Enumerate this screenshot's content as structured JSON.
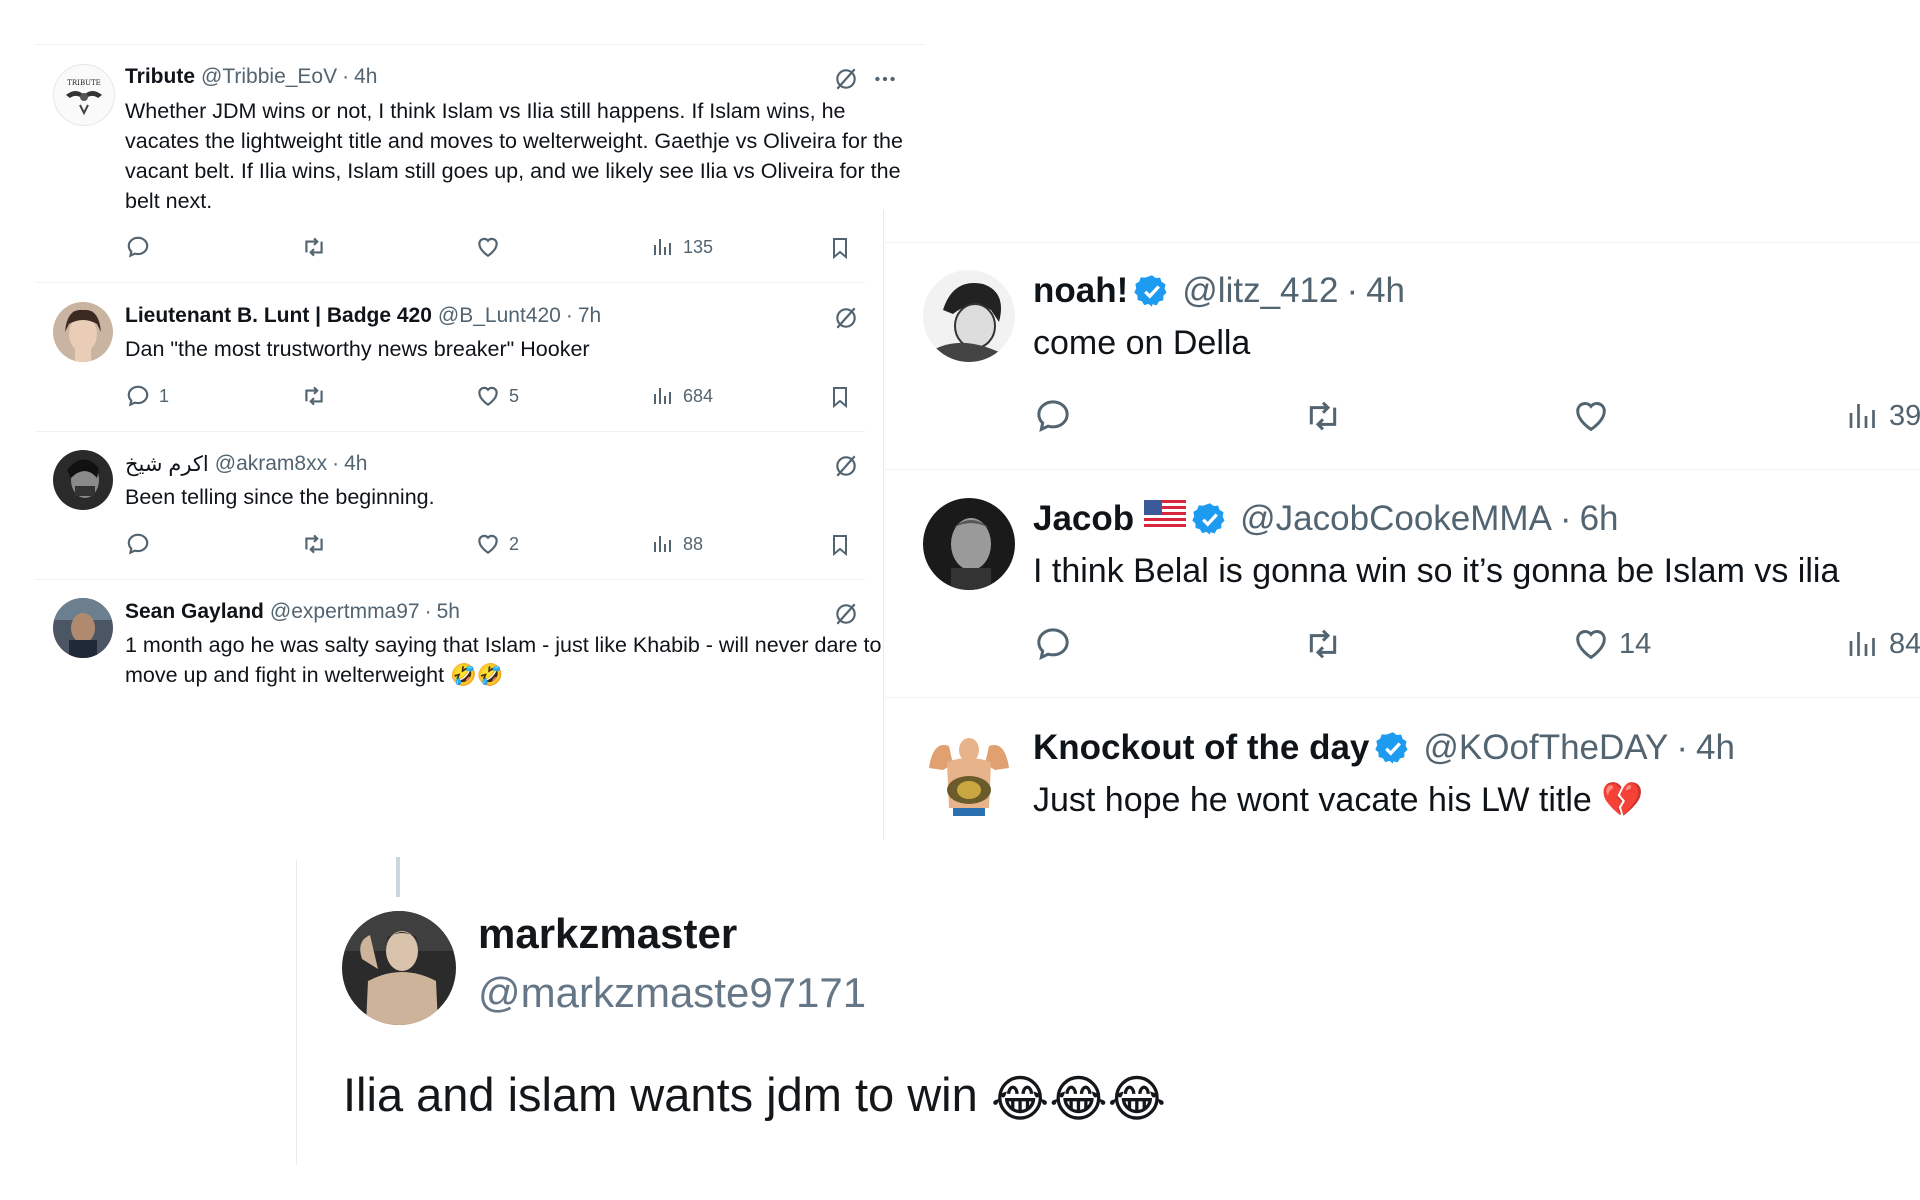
{
  "small_feed": {
    "tweets": [
      {
        "name": "Tribute",
        "handle": "@Tribbie_EoV",
        "time": "4h",
        "text": "Whether JDM wins or not, I think Islam vs Ilia still happens. If Islam wins, he vacates the lightweight title and moves to welterweight. Gaethje vs Oliveira for the vacant belt. If Ilia wins, Islam still goes up, and we likely see Ilia vs Oliveira for the belt next.",
        "replies": "",
        "likes": "",
        "views": "135"
      },
      {
        "name": "Lieutenant B. Lunt | Badge 420",
        "handle": "@B_Lunt420",
        "time": "7h",
        "text": "Dan \"the most trustworthy news breaker\" Hooker",
        "replies": "1",
        "likes": "5",
        "views": "684"
      },
      {
        "name": "اكرم شيخ",
        "handle": "@akram8xx",
        "time": "4h",
        "text": "Been telling since the beginning.",
        "replies": "",
        "likes": "2",
        "views": "88"
      },
      {
        "name": "Sean Gayland",
        "handle": "@expertmma97",
        "time": "5h",
        "text": "1 month ago he was salty saying that Islam - just like Khabib - will never dare to move up and fight in welterweight 🤣🤣"
      }
    ]
  },
  "large_feed": {
    "tweets": [
      {
        "name": "noah!",
        "handle": "@litz_412",
        "time": "4h",
        "text": "come on Della",
        "likes": "",
        "views": "39"
      },
      {
        "name": "Jacob",
        "handle": "@JacobCookeMMA",
        "time": "6h",
        "text": "I think Belal is gonna win so it’s gonna be Islam vs ilia",
        "likes": "14",
        "views": "84"
      },
      {
        "name": "Knockout of the day",
        "handle": "@KOofTheDAY",
        "time": "4h",
        "text": "Just hope he wont vacate his LW title 💔"
      }
    ]
  },
  "reply_card": {
    "name": "markzmaster",
    "handle": "@markzmaste97171",
    "text": "Ilia and islam wants jdm to win",
    "emojis": "😂😂😂"
  },
  "colors": {
    "text": "#0f1419",
    "secondary": "#536471",
    "verified": "#1d9bf0",
    "divider": "#eff3f4"
  },
  "icons": [
    "reply-icon",
    "retweet-icon",
    "like-icon",
    "views-icon",
    "bookmark-icon",
    "grok-icon",
    "more-icon",
    "verified-icon"
  ]
}
